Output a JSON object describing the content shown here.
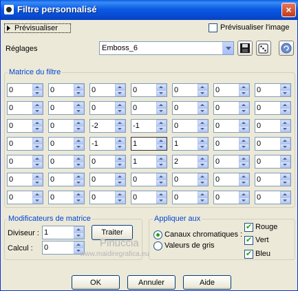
{
  "window": {
    "title": "Filtre personnalisé",
    "close_glyph": "×"
  },
  "preview_button": "Prévisualiser",
  "preview_image_label": "Prévisualiser l'image",
  "preview_image_checked": false,
  "presets": {
    "label": "Réglages",
    "selected": "Emboss_6"
  },
  "matrix": {
    "label": "Matrice du filtre",
    "rows": [
      [
        "0",
        "0",
        "0",
        "0",
        "0",
        "0",
        "0"
      ],
      [
        "0",
        "0",
        "0",
        "0",
        "0",
        "0",
        "0"
      ],
      [
        "0",
        "0",
        "-2",
        "-1",
        "0",
        "0",
        "0"
      ],
      [
        "0",
        "0",
        "-1",
        "1",
        "1",
        "0",
        "0"
      ],
      [
        "0",
        "0",
        "0",
        "1",
        "2",
        "0",
        "0"
      ],
      [
        "0",
        "0",
        "0",
        "0",
        "0",
        "0",
        "0"
      ],
      [
        "0",
        "0",
        "0",
        "0",
        "0",
        "0",
        "0"
      ]
    ]
  },
  "modifiers": {
    "label": "Modificateurs de matrice",
    "divisor_label": "Diviseur :",
    "divisor_value": "1",
    "bias_label": "Calcul :",
    "bias_value": "0",
    "compute_button": "Traiter"
  },
  "apply_to": {
    "label": "Appliquer aux",
    "color_channels": "Canaux chromatiques :",
    "grey_values": "Valeurs de gris",
    "selected": "color_channels",
    "channels": [
      {
        "label": "Rouge",
        "checked": true
      },
      {
        "label": "Vert",
        "checked": true
      },
      {
        "label": "Bleu",
        "checked": true
      }
    ]
  },
  "watermark": {
    "name": "Pinuccia",
    "url": "www.maidiregrafica.eu"
  },
  "buttons": {
    "ok": "OK",
    "cancel": "Annuler",
    "help": "Aide"
  },
  "colors": {
    "titlebar": "#0a5be4",
    "group_label": "#0046d5",
    "face": "#ece9d8"
  }
}
